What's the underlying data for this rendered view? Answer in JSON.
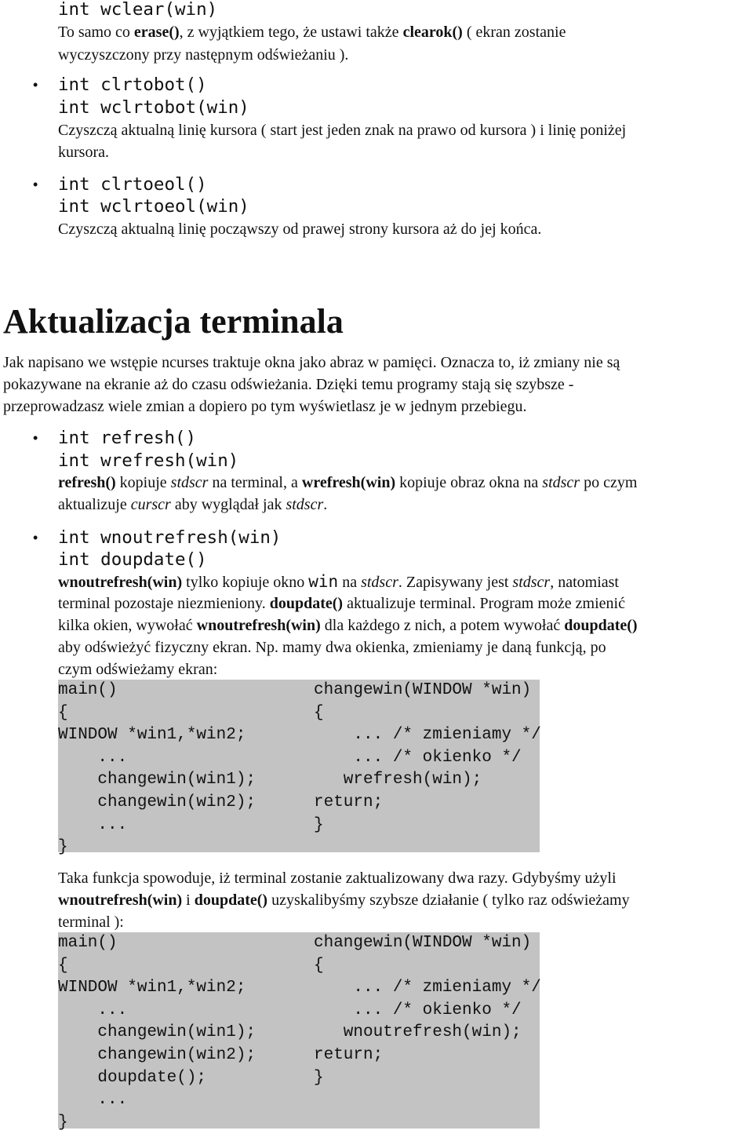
{
  "lines": [
    [
      {
        "t": "int wclear(win)",
        "s": ""
      }
    ],
    [
      {
        "t": "To samo co ",
        "s": ""
      },
      {
        "t": "erase()",
        "s": "b"
      },
      {
        "t": ", z wyjątkiem tego, że ustawi także ",
        "s": ""
      },
      {
        "t": "clearok()",
        "s": "b"
      },
      {
        "t": " ( ekran zostanie",
        "s": ""
      }
    ],
    [
      {
        "t": "wyczyszczony przy następnym odświeżaniu ).",
        "s": ""
      }
    ],
    [
      {
        "t": "int clrtobot()",
        "s": ""
      }
    ],
    [
      {
        "t": "int wclrtobot(win)",
        "s": ""
      }
    ],
    [
      {
        "t": "Czyszczą aktualną linię kursora ( start jest jeden znak na prawo od kursora ) i linię poniżej",
        "s": ""
      }
    ],
    [
      {
        "t": "kursora.",
        "s": ""
      }
    ],
    [
      {
        "t": "int clrtoeol()",
        "s": ""
      }
    ],
    [
      {
        "t": "int wclrtoeol(win)",
        "s": ""
      }
    ],
    [
      {
        "t": "Czyszczą aktualną linię począwszy od prawej strony kursora aż do jej końca.",
        "s": ""
      }
    ],
    [
      {
        "t": "Aktualizacja terminala",
        "s": ""
      }
    ],
    [
      {
        "t": "Jak napisano we wstępie ncurses traktuje okna jako abraz w pamięci. Oznacza to, iż zmiany nie są",
        "s": ""
      }
    ],
    [
      {
        "t": "pokazywane na ekranie aż do czasu odświeżania. Dzięki temu programy stają się szybsze -",
        "s": ""
      }
    ],
    [
      {
        "t": "przeprowadzasz wiele zmian a dopiero po tym wyświetlasz je w jednym przebiegu.",
        "s": ""
      }
    ],
    [
      {
        "t": "int refresh()",
        "s": ""
      }
    ],
    [
      {
        "t": "int wrefresh(win)",
        "s": ""
      }
    ],
    [
      {
        "t": "refresh()",
        "s": "b"
      },
      {
        "t": " kopiuje ",
        "s": ""
      },
      {
        "t": "stdscr",
        "s": "i"
      },
      {
        "t": " na terminal, a ",
        "s": ""
      },
      {
        "t": "wrefresh(win)",
        "s": "b"
      },
      {
        "t": " kopiuje obraz okna na ",
        "s": ""
      },
      {
        "t": "stdscr",
        "s": "i"
      },
      {
        "t": " po czym",
        "s": ""
      }
    ],
    [
      {
        "t": "aktualizuje ",
        "s": ""
      },
      {
        "t": "curscr",
        "s": "i"
      },
      {
        "t": " aby wyglądał jak ",
        "s": ""
      },
      {
        "t": "stdscr",
        "s": "i"
      },
      {
        "t": ".",
        "s": ""
      }
    ],
    [
      {
        "t": "int wnoutrefresh(win)",
        "s": ""
      }
    ],
    [
      {
        "t": "int doupdate()",
        "s": ""
      }
    ],
    [
      {
        "t": "wnoutrefresh(win)",
        "s": "b"
      },
      {
        "t": " tylko kopiuje okno ",
        "s": ""
      },
      {
        "t": "win",
        "s": "m"
      },
      {
        "t": " na ",
        "s": ""
      },
      {
        "t": "stdscr",
        "s": "i"
      },
      {
        "t": ". Zapisywany jest ",
        "s": ""
      },
      {
        "t": "stdscr",
        "s": "i"
      },
      {
        "t": ", natomiast",
        "s": ""
      }
    ],
    [
      {
        "t": "terminal pozostaje niezmieniony. ",
        "s": ""
      },
      {
        "t": "doupdate()",
        "s": "b"
      },
      {
        "t": " aktualizuje terminal. Program może zmienić",
        "s": ""
      }
    ],
    [
      {
        "t": "kilka okien, wywołać ",
        "s": ""
      },
      {
        "t": "wnoutrefresh(win)",
        "s": "b"
      },
      {
        "t": " dla każdego z nich, a potem wywołać ",
        "s": ""
      },
      {
        "t": "doupdate()",
        "s": "b"
      }
    ],
    [
      {
        "t": "aby odświeżyć fizyczny ekran. Np. mamy dwa okienka, zmieniamy je daną funkcją, po",
        "s": ""
      }
    ],
    [
      {
        "t": "czym odświeżamy ekran:",
        "s": ""
      }
    ],
    [
      {
        "t": "Taka funkcja spowoduje, iż terminal zostanie zaktualizowany dwa razy. Gdybyśmy użyli",
        "s": ""
      }
    ],
    [
      {
        "t": "wnoutrefresh(win)",
        "s": "b"
      },
      {
        "t": " i ",
        "s": ""
      },
      {
        "t": "doupdate()",
        "s": "b"
      },
      {
        "t": " uzyskalibyśmy szybsze działanie ( tylko raz odświeżamy",
        "s": ""
      }
    ],
    [
      {
        "t": "terminal ):",
        "s": ""
      }
    ]
  ],
  "bullet_char": "•",
  "code_blocks": [
    {
      "left": "main()\n{\nWINDOW *win1,*win2;\n    ...\n    changewin(win1);\n    changewin(win2);\n    ...\n}",
      "right": "changewin(WINDOW *win)\n{\n    ... /* zmieniamy */\n    ... /* okienko */\n   wrefresh(win);\nreturn;\n}"
    },
    {
      "left": "main()\n{\nWINDOW *win1,*win2;\n    ...\n    changewin(win1);\n    changewin(win2);\n    doupdate();\n    ...\n}",
      "right": "changewin(WINDOW *win)\n{\n    ... /* zmieniamy */\n    ... /* okienko */\n   wnoutrefresh(win);\nreturn;\n}"
    }
  ],
  "colors": {
    "code_background": "#c3c3c3",
    "text": "#111111"
  }
}
